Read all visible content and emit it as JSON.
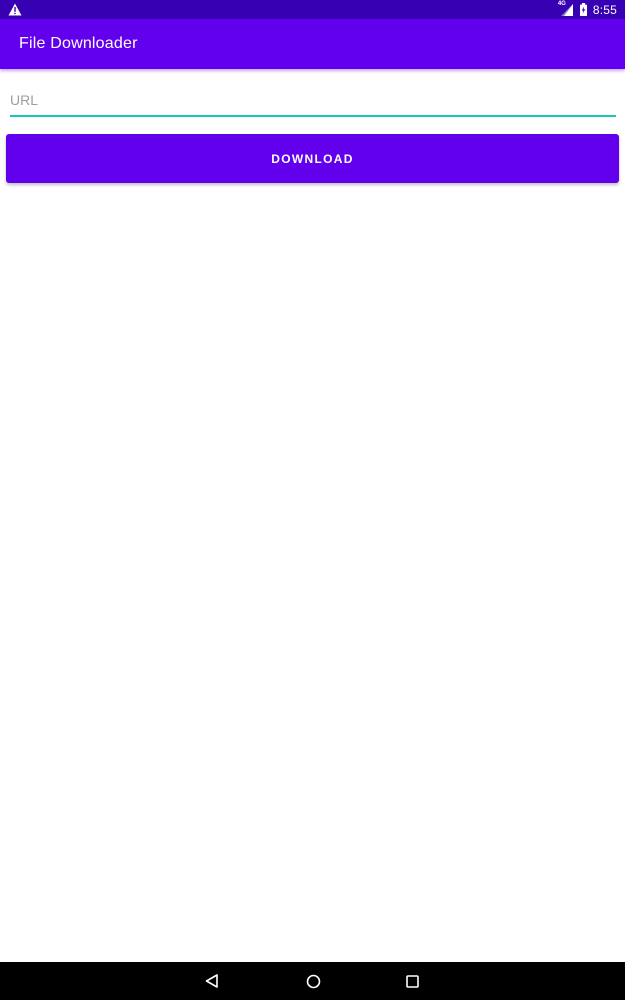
{
  "status_bar": {
    "time": "8:55",
    "network_label": "4G",
    "icons": [
      "warning-icon",
      "signal-icon",
      "battery-icon"
    ]
  },
  "app_bar": {
    "title": "File Downloader"
  },
  "form": {
    "url_placeholder": "URL",
    "url_value": "",
    "download_label": "DOWNLOAD"
  },
  "nav_bar": {
    "icons": [
      "back-icon",
      "home-icon",
      "recents-icon"
    ]
  },
  "colors": {
    "status_bar": "#3700B3",
    "primary": "#6200EE",
    "accent_underline": "#18C6B4",
    "nav_bar": "#000000"
  }
}
